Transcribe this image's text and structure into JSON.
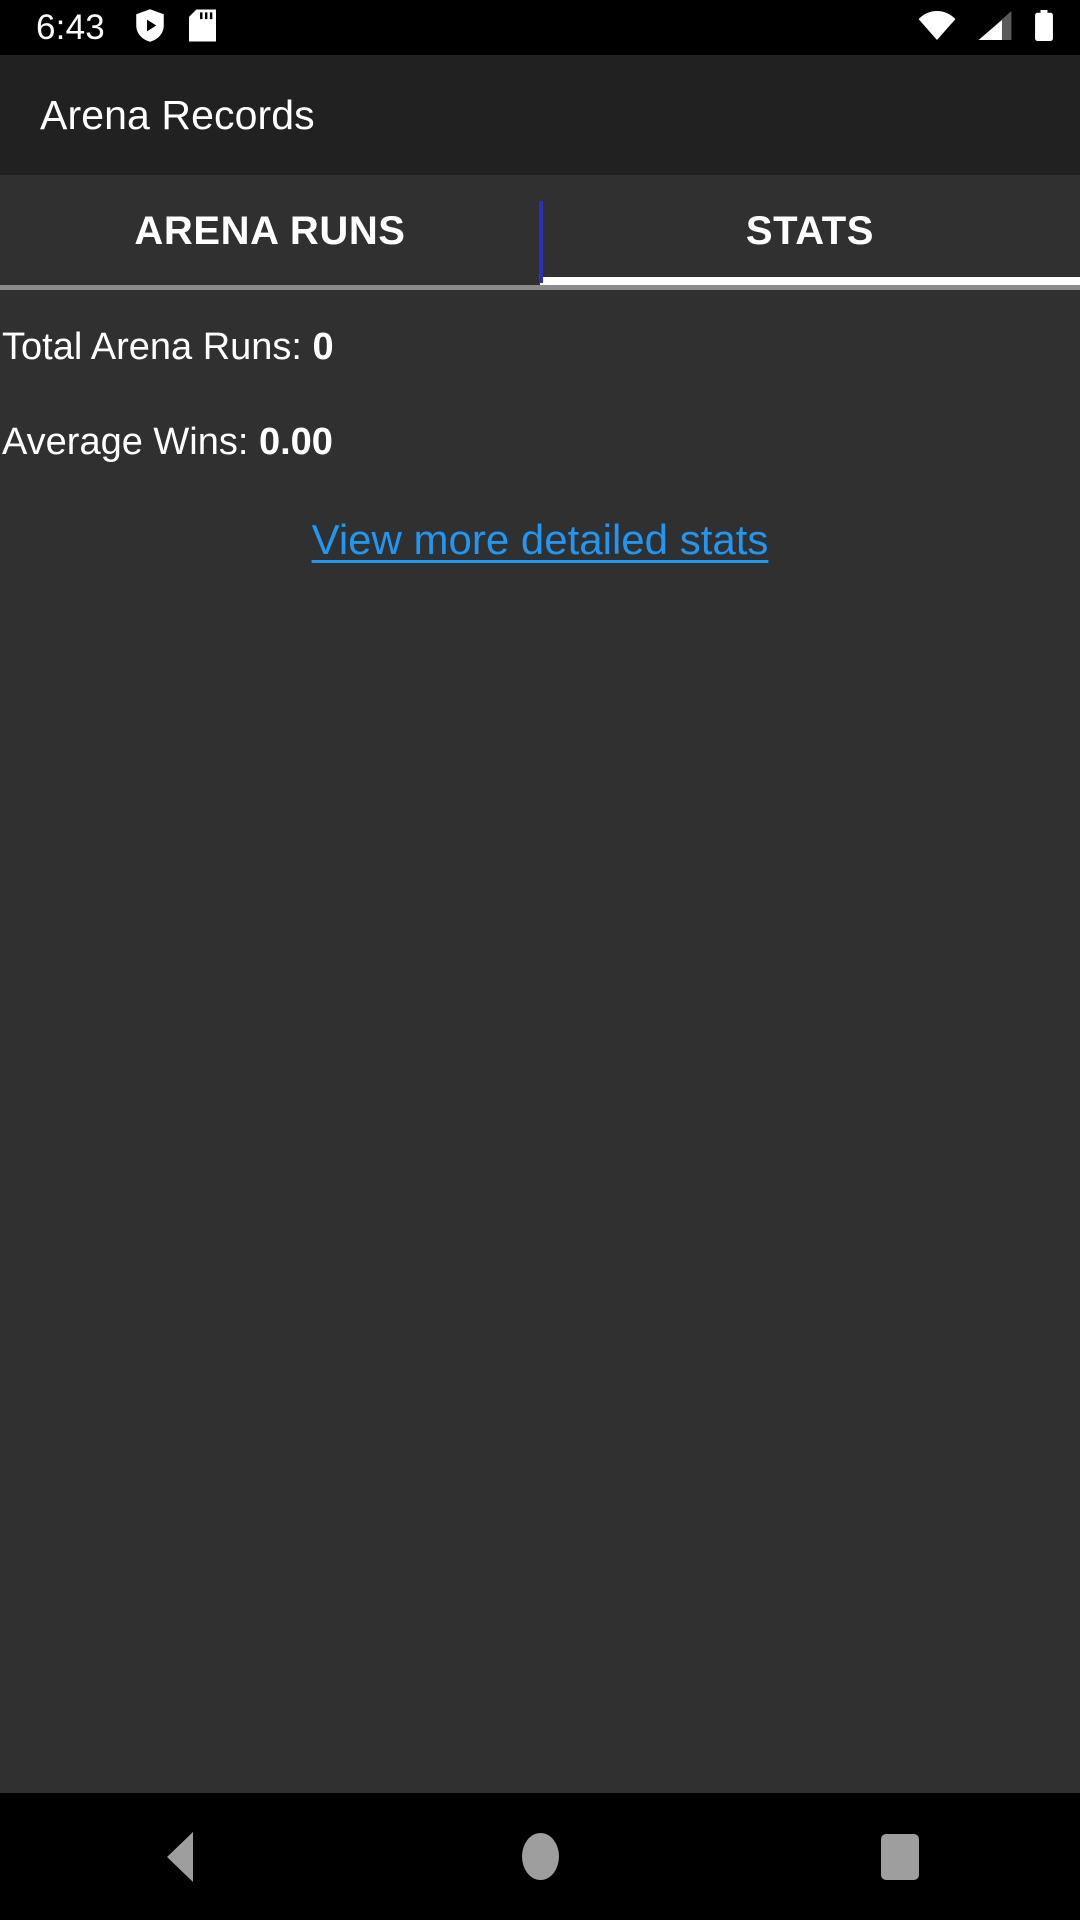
{
  "status_bar": {
    "clock": "6:43",
    "left_icons": [
      "shield-play-icon",
      "sd-card-icon"
    ],
    "right_icons": [
      "wifi-icon",
      "cellular-signal-icon",
      "battery-icon"
    ]
  },
  "app_bar": {
    "title": "Arena Records"
  },
  "tabs": [
    {
      "label": "Arena Runs",
      "selected": false
    },
    {
      "label": "Stats",
      "selected": true
    }
  ],
  "stats": {
    "total_runs": {
      "label": "Total Arena Runs: ",
      "value": "0"
    },
    "average_wins": {
      "label": "Average Wins: ",
      "value": "0.00"
    },
    "detail_link": "View more detailed stats"
  },
  "nav_bar": {
    "back": "back-button",
    "home": "home-button",
    "recents": "recents-button"
  },
  "colors": {
    "status_bar_bg": "#000000",
    "app_bar_bg": "#212121",
    "content_bg": "#303030",
    "accent_link": "#2196f3",
    "tab_divider": "#2d2dbf",
    "tab_indicator": "#ffffff",
    "divider_line": "#8b8b8b",
    "nav_glyph": "#9e9e9e",
    "text_primary": "#ffffff"
  }
}
